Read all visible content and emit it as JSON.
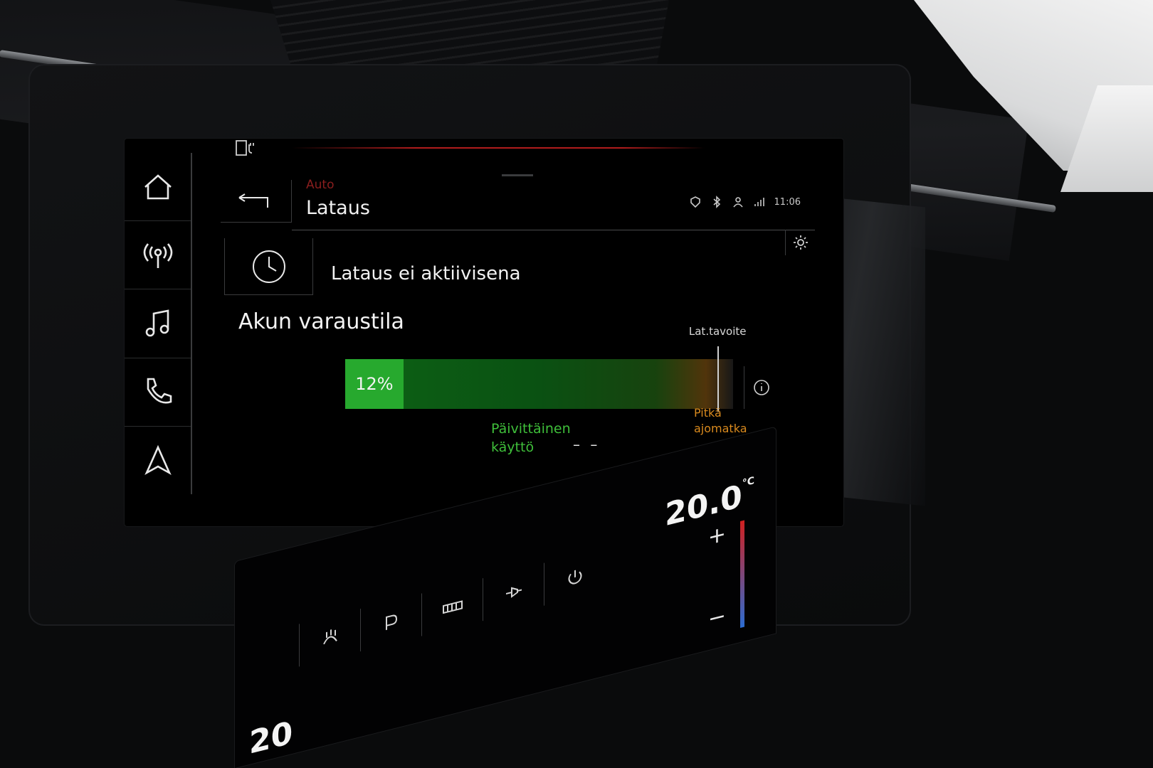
{
  "header": {
    "breadcrumb": "Auto",
    "title": "Lataus",
    "time": "11:06"
  },
  "charging": {
    "status": "Lataus ei aktiivisena"
  },
  "battery": {
    "section_title": "Akun varaustila",
    "level_percent": 12,
    "level_label": "12%",
    "target_label": "Lat.tavoite",
    "daily_label_line1": "Päivittäinen",
    "daily_label_line2": "käyttö",
    "daily_value": "– –",
    "long_label_line1": "Pitkä",
    "long_label_line2": "ajomatka"
  },
  "sidebar": {
    "items": [
      {
        "name": "home-icon"
      },
      {
        "name": "radio-icon"
      },
      {
        "name": "music-icon"
      },
      {
        "name": "phone-icon"
      },
      {
        "name": "navigation-icon"
      }
    ]
  },
  "climate": {
    "temp_right": "20.0",
    "temp_unit": "°C",
    "temp_left": "20"
  },
  "colors": {
    "accent_red": "#b01c1c",
    "battery_green": "#27a92e",
    "daily_green": "#3fbf3a",
    "long_orange": "#d98a1e"
  }
}
